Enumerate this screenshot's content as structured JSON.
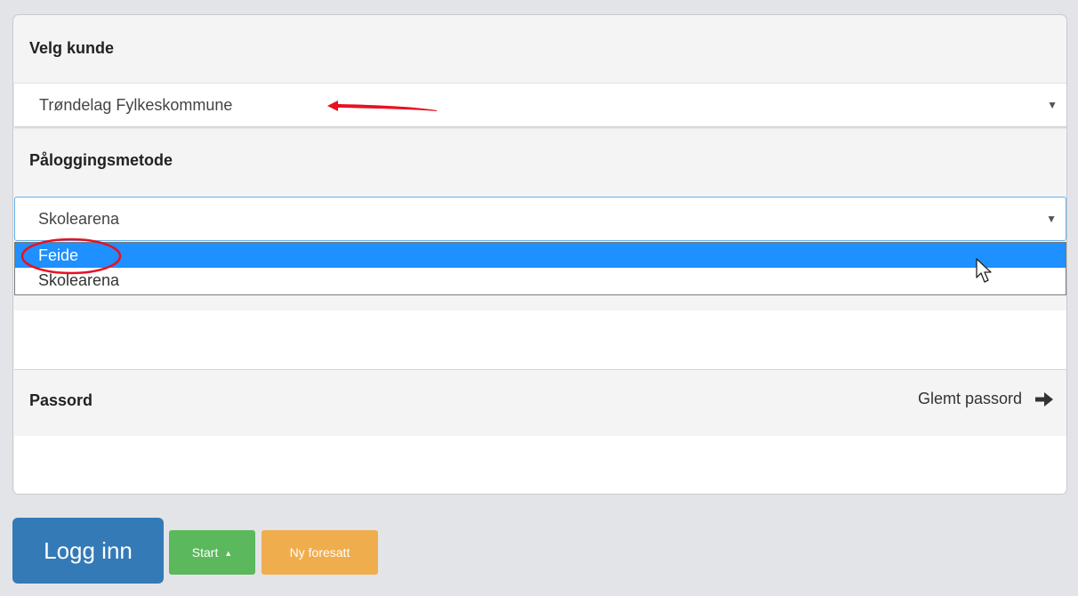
{
  "customer": {
    "label": "Velg kunde",
    "selected": "Trøndelag Fylkeskommune"
  },
  "login_method": {
    "label": "Påloggingsmetode",
    "selected": "Skolearena",
    "options": [
      "Feide",
      "Skolearena"
    ]
  },
  "password": {
    "label": "Passord",
    "forgot_label": "Glemt passord"
  },
  "buttons": {
    "login": "Logg inn",
    "start": "Start",
    "new_guardian": "Ny foresatt"
  },
  "icons": {
    "caret": "caret-down-icon",
    "arrow_right": "arrow-right-icon",
    "caret_up": "caret-up-icon",
    "cursor": "mouse-pointer-icon"
  },
  "colors": {
    "primary": "#337ab7",
    "success": "#5cb85c",
    "warning": "#f0ad4e",
    "highlight": "#1e90ff",
    "annotation": "#e81123"
  }
}
